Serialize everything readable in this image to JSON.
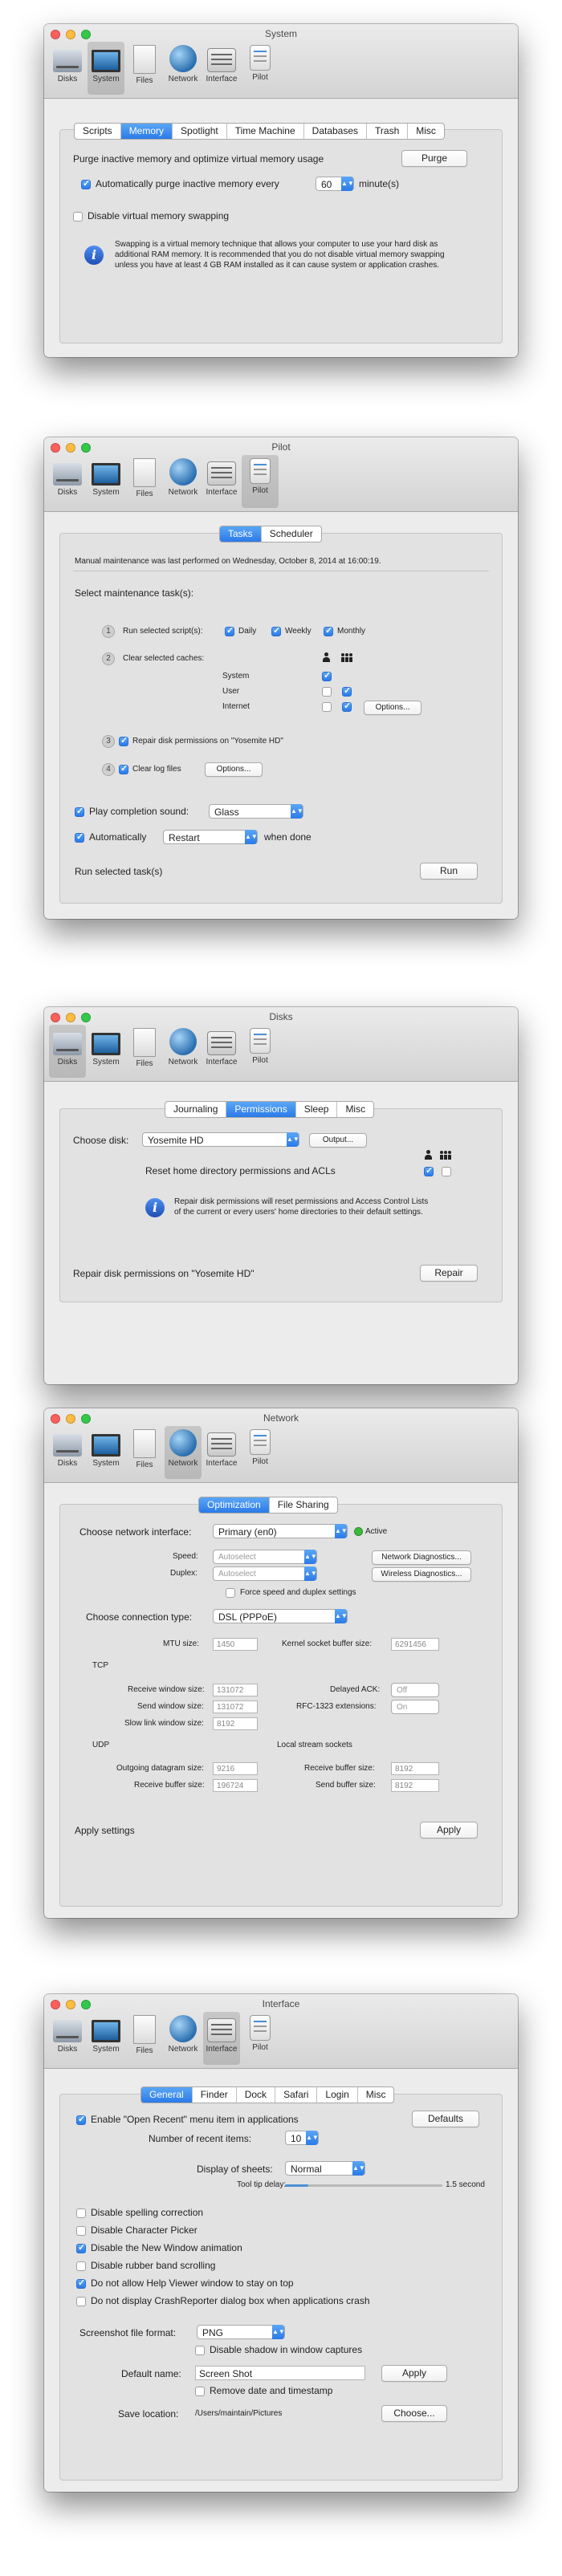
{
  "toolbar": {
    "disks": "Disks",
    "system": "System",
    "files": "Files",
    "network": "Network",
    "interface": "Interface",
    "pilot": "Pilot"
  },
  "system_window": {
    "title": "System",
    "tabs": [
      "Scripts",
      "Memory",
      "Spotlight",
      "Time Machine",
      "Databases",
      "Trash",
      "Misc"
    ],
    "selected_tab": "Memory",
    "purge_text": "Purge inactive memory and optimize virtual memory usage",
    "purge_button": "Purge",
    "auto_purge_label": "Automatically purge inactive memory every",
    "auto_purge_value": "60",
    "auto_purge_unit": "minute(s)",
    "disable_swap_label": "Disable virtual memory swapping",
    "info_line1": "Swapping is a virtual memory technique that allows your computer to use your hard disk as",
    "info_line2": "additional RAM memory. It is recommended that you do not disable virtual memory swapping",
    "info_line3": "unless you have at least 4 GB RAM installed as it can cause system or application crashes."
  },
  "pilot_window": {
    "title": "Pilot",
    "tabs": [
      "Tasks",
      "Scheduler"
    ],
    "selected_tab": "Tasks",
    "last_maintenance": "Manual maintenance was last performed on Wednesday, October 8, 2014 at 16:00:19.",
    "select_tasks": "Select maintenance task(s):",
    "task1_label": "Run selected script(s):",
    "daily": "Daily",
    "weekly": "Weekly",
    "monthly": "Monthly",
    "task2_label": "Clear selected caches:",
    "cache_system": "System",
    "cache_user": "User",
    "cache_internet": "Internet",
    "options": "Options...",
    "task3_label": "Repair disk permissions on \"Yosemite HD\"",
    "task4_label": "Clear log files",
    "play_sound_label": "Play completion sound:",
    "sound_value": "Glass",
    "auto_label": "Automatically",
    "auto_value": "Restart",
    "when_done": "when done",
    "run_text": "Run selected task(s)",
    "run_button": "Run",
    "n1": "1",
    "n2": "2",
    "n3": "3",
    "n4": "4"
  },
  "disks_window": {
    "title": "Disks",
    "tabs": [
      "Journaling",
      "Permissions",
      "Sleep",
      "Misc"
    ],
    "selected_tab": "Permissions",
    "choose_disk": "Choose disk:",
    "disk_value": "Yosemite HD",
    "output_button": "Output...",
    "reset_label": "Reset home directory permissions and ACLs",
    "info_line1": "Repair disk permissions will reset permissions and Access Control Lists",
    "info_line2": "of the current or every users' home directories to their default settings.",
    "repair_text": "Repair disk permissions on \"Yosemite HD\"",
    "repair_button": "Repair"
  },
  "network_window": {
    "title": "Network",
    "tabs": [
      "Optimization",
      "File Sharing"
    ],
    "selected_tab": "Optimization",
    "choose_interface": "Choose network interface:",
    "interface_value": "Primary (en0)",
    "active": "Active",
    "speed_label": "Speed:",
    "speed_value": "Autoselect",
    "duplex_label": "Duplex:",
    "duplex_value": "Autoselect",
    "net_diag": "Network Diagnostics...",
    "wireless_diag": "Wireless Diagnostics...",
    "force_label": "Force speed and duplex settings",
    "conn_type_label": "Choose connection type:",
    "conn_type_value": "DSL (PPPoE)",
    "mtu_label": "MTU size:",
    "mtu_value": "1450",
    "kernel_label": "Kernel socket buffer size:",
    "kernel_value": "6291456",
    "tcp": "TCP",
    "recv_win_label": "Receive window size:",
    "recv_win_value": "131072",
    "delayed_ack_label": "Delayed ACK:",
    "delayed_ack_value": "Off",
    "send_win_label": "Send window size:",
    "send_win_value": "131072",
    "rfc_label": "RFC-1323 extensions:",
    "rfc_value": "On",
    "slow_link_label": "Slow link window size:",
    "slow_link_value": "8192",
    "udp": "UDP",
    "local_stream": "Local stream sockets",
    "out_dgram_label": "Outgoing datagram size:",
    "out_dgram_value": "9216",
    "recv_buf_label": "Receive buffer size:",
    "recv_buf_value": "196724",
    "local_recv_label": "Receive buffer size:",
    "local_recv_value": "8192",
    "local_send_label": "Send buffer size:",
    "local_send_value": "8192",
    "apply_text": "Apply settings",
    "apply_button": "Apply"
  },
  "interface_window": {
    "title": "Interface",
    "tabs": [
      "General",
      "Finder",
      "Dock",
      "Safari",
      "Login",
      "Misc"
    ],
    "selected_tab": "General",
    "open_recent_label": "Enable \"Open Recent\" menu item in applications",
    "defaults_button": "Defaults",
    "recent_items_label": "Number of recent items:",
    "recent_items_value": "10",
    "sheets_label": "Display of sheets:",
    "sheets_value": "Normal",
    "tooltip_label": "Tool tip delay:",
    "tooltip_value": "1.5 second",
    "tooltip_fraction": 0.15,
    "opt_spelling": "Disable spelling correction",
    "opt_charpicker": "Disable Character Picker",
    "opt_newwindow": "Disable the New Window animation",
    "opt_rubber": "Disable rubber band scrolling",
    "opt_helpviewer": "Do not allow Help Viewer window to stay on top",
    "opt_crash": "Do not display CrashReporter dialog box when applications crash",
    "screenshot_format_label": "Screenshot file format:",
    "screenshot_format_value": "PNG",
    "disable_shadow_label": "Disable shadow in window captures",
    "default_name_label": "Default name:",
    "default_name_value": "Screen Shot",
    "apply_button": "Apply",
    "remove_date_label": "Remove date and timestamp",
    "save_location_label": "Save location:",
    "save_location_value": "/Users/maintain/Pictures",
    "choose_button": "Choose..."
  }
}
